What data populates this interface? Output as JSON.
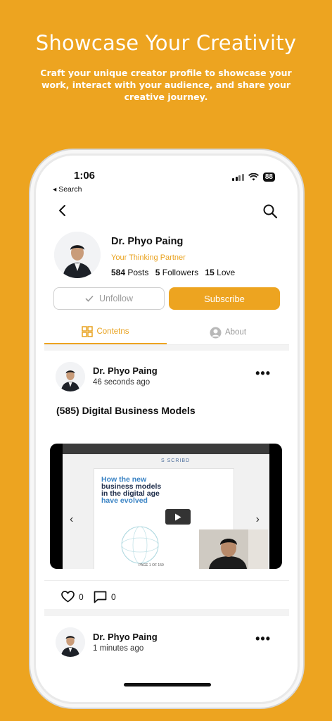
{
  "hero": {
    "title": "Showcase Your Creativity",
    "subtitle": "Craft your unique creator profile to showcase your work, interact with your audience, and share your creative journey."
  },
  "status_bar": {
    "time": "1:06",
    "back_label": "◂ Search",
    "battery": "88"
  },
  "profile": {
    "name": "Dr. Phyo Paing",
    "tagline": "Your Thinking Partner",
    "posts_count": "584",
    "posts_label": "Posts",
    "followers_count": "5",
    "followers_label": "Followers",
    "love_count": "15",
    "love_label": "Love"
  },
  "actions": {
    "unfollow_label": "Unfollow",
    "subscribe_label": "Subscribe"
  },
  "tabs": [
    {
      "label": "Contetns",
      "active": true
    },
    {
      "label": "About",
      "active": false
    }
  ],
  "posts": [
    {
      "author": "Dr. Phyo Paing",
      "time": "46 seconds ago",
      "title": "(585) Digital Business Models",
      "likes": "0",
      "comments": "0",
      "video": {
        "site_logo": "S SCRIBD",
        "slide_heading": [
          "How the new",
          "business models",
          "in the digital age",
          "have evolved"
        ],
        "page_indicator": "PAGE 1 OF 159"
      }
    },
    {
      "author": "Dr. Phyo Paing",
      "time": "1 minutes ago"
    }
  ],
  "colors": {
    "accent": "#EDA420",
    "accent_text": "#E9A21E",
    "background": "#EDA420"
  }
}
